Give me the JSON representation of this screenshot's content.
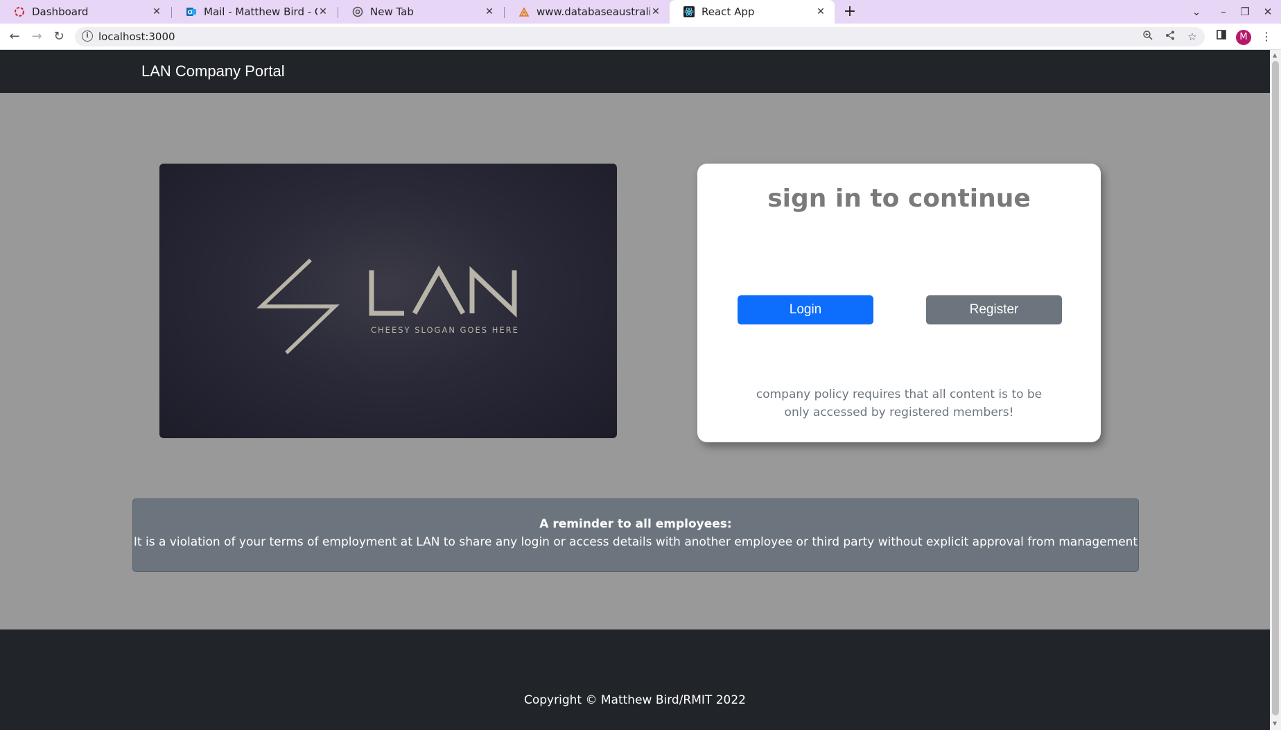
{
  "browser": {
    "tabs": [
      {
        "title": "Dashboard",
        "icon": "dashboard-favicon",
        "active": false
      },
      {
        "title": "Mail - Matthew Bird - Outl",
        "icon": "outlook-favicon",
        "active": false
      },
      {
        "title": "New Tab",
        "icon": "chrome-favicon",
        "active": false
      },
      {
        "title": "www.databaseaustralia.c",
        "icon": "database-australia-favicon",
        "active": false
      },
      {
        "title": "React App",
        "icon": "react-favicon",
        "active": true
      }
    ],
    "url": "localhost:3000",
    "profile_initial": "M",
    "colors": {
      "tabbar": "#e7d6f5",
      "avatar": "#b5176a"
    }
  },
  "header": {
    "brand": "LAN Company Portal"
  },
  "hero": {
    "logo_text": "LAN",
    "slogan": "CHEESY SLOGAN GOES HERE"
  },
  "signin": {
    "title": "sign in to continue",
    "login_label": "Login",
    "register_label": "Register",
    "policy": "company policy requires that all content is to be only accessed by registered members!"
  },
  "notice": {
    "title": "A reminder to all employees:",
    "body": "It is a violation of your terms of employment at LAN to share any login or access details with another employee or third party without explicit approval from management"
  },
  "footer": {
    "copyright": "Copyright © Matthew Bird/RMIT 2022"
  },
  "colors": {
    "page_bg": "#999999",
    "header_bg": "#212529",
    "primary": "#0d6efd",
    "secondary": "#6c757d"
  }
}
